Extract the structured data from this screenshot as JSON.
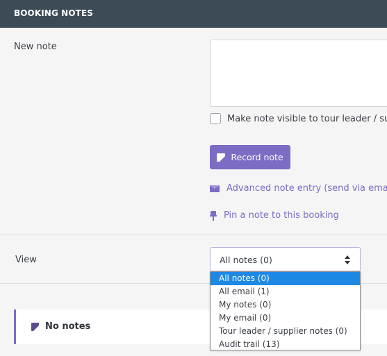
{
  "header": {
    "title": "BOOKING NOTES"
  },
  "new_note": {
    "label": "New note",
    "textarea_value": "",
    "visibility_checkbox_label": "Make note visible to tour leader / supp",
    "visibility_checked": false,
    "record_button": "Record note",
    "advanced_link": "Advanced note entry (send via email)",
    "pin_link": "Pin a note to this booking"
  },
  "view": {
    "label": "View",
    "selected": "All notes (0)",
    "options": [
      "All notes (0)",
      "All email (1)",
      "My notes (0)",
      "My email (0)",
      "Tour leader / supplier notes (0)",
      "Audit trail (13)"
    ]
  },
  "notes_panel": {
    "empty_text": "No notes"
  },
  "colors": {
    "header_bg": "#3d4b57",
    "accent": "#7e6bc4",
    "selected_option": "#1e88e5",
    "page_bg": "#f5f5f6"
  },
  "icons": [
    "note-icon",
    "envelope-icon",
    "pin-icon",
    "sort-arrows-icon"
  ]
}
